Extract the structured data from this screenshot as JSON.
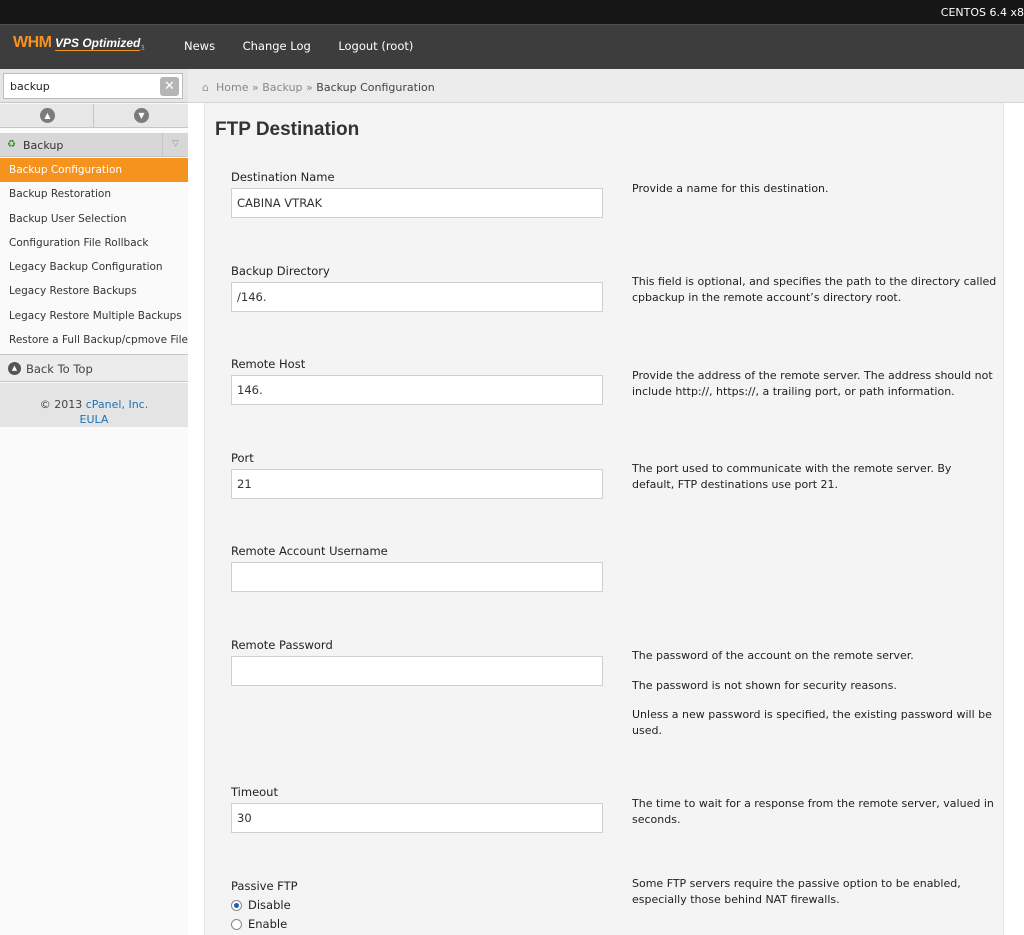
{
  "os_info": "CENTOS 6.4 x8",
  "header": {
    "logo_whm": "WHM",
    "logo_vps": "VPS Optimized",
    "logo_sub": "3",
    "nav": [
      "News",
      "Change Log",
      "Logout (root)"
    ]
  },
  "sidebar": {
    "search_value": "backup",
    "clear_label": "✕",
    "group_label": "Backup",
    "items": [
      {
        "label": "Backup Configuration",
        "active": true
      },
      {
        "label": "Backup Restoration",
        "active": false
      },
      {
        "label": "Backup User Selection",
        "active": false
      },
      {
        "label": "Configuration File Rollback",
        "active": false
      },
      {
        "label": "Legacy Backup Configuration",
        "active": false
      },
      {
        "label": "Legacy Restore Backups",
        "active": false
      },
      {
        "label": "Legacy Restore Multiple Backups",
        "active": false
      },
      {
        "label": "Restore a Full Backup/cpmove File",
        "active": false
      }
    ],
    "back_to_top": "Back To Top",
    "copyright_prefix": "© 2013",
    "copyright_link": "cPanel, Inc.",
    "eula": "EULA"
  },
  "breadcrumb": {
    "home": "Home",
    "sep": "»",
    "section": "Backup",
    "current": "Backup Configuration"
  },
  "page": {
    "title": "FTP Destination",
    "fields": [
      {
        "label": "Destination Name",
        "value": "CABINA VTRAK",
        "help": [
          "Provide a name for this destination."
        ]
      },
      {
        "label": "Backup Directory",
        "value": "/146.",
        "help": [
          "This field is optional, and specifies the path to the directory called cpbackup in the remote account’s directory root."
        ]
      },
      {
        "label": "Remote Host",
        "value": "146.",
        "help": [
          "Provide the address of the remote server. The address should not include http://, https://, a trailing port, or path information."
        ]
      },
      {
        "label": "Port",
        "value": "21",
        "help": [
          "The port used to communicate with the remote server. By default, FTP destinations use port 21."
        ]
      },
      {
        "label": "Remote Account Username",
        "value": "",
        "help": []
      },
      {
        "label": "Remote Password",
        "value": "",
        "help": [
          "The password of the account on the remote server.",
          "The password is not shown for security reasons.",
          "Unless a new password is specified, the existing password will be used."
        ]
      },
      {
        "label": "Timeout",
        "value": "30",
        "help": [
          "The time to wait for a response from the remote server, valued in seconds."
        ]
      }
    ],
    "passive": {
      "label": "Passive FTP",
      "options": [
        "Disable",
        "Enable"
      ],
      "selected": "Disable",
      "help": "Some FTP servers require the passive option to be enabled, especially those behind NAT firewalls."
    }
  }
}
